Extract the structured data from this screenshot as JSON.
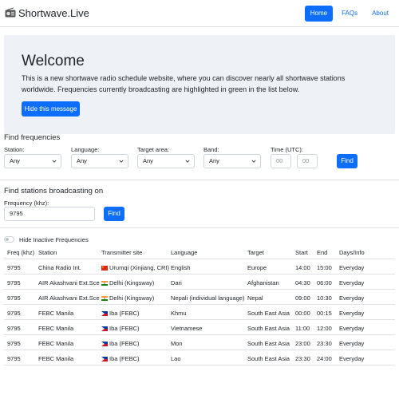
{
  "nav": {
    "brand": "Shortwave.Live",
    "links": [
      "Home",
      "FAQs",
      "About"
    ]
  },
  "hero": {
    "title": "Welcome",
    "text": "This is a new shortwave radio schedule website, where you can discover nearly all shortwave stations worldwide. Frequencies currently broadcasting are highlighted in green in the list below.",
    "button": "Hide this message"
  },
  "find_frequencies": {
    "title": "Find frequencies",
    "station_label": "Station:",
    "station_value": "Any",
    "language_label": "Language:",
    "language_value": "Any",
    "target_label": "Target area:",
    "target_value": "Any",
    "band_label": "Band:",
    "band_value": "Any",
    "time_label": "Time (UTC):",
    "time_placeholder_1": "00",
    "time_placeholder_2": "00",
    "find_button": "Find"
  },
  "find_stations": {
    "title": "Find stations broadcasting on",
    "freq_label": "Frequency (khz):",
    "freq_value": "9795",
    "find_button": "Find"
  },
  "toggle": {
    "label": "Hide Inactive Frequencies"
  },
  "table": {
    "headers": [
      "Freq (khz)",
      "Station",
      "Transmitter site",
      "Language",
      "Target",
      "Start",
      "End",
      "Days/Info"
    ],
    "rows": [
      {
        "freq": "9795",
        "station": "China Radio Int.",
        "flag": "cn",
        "site": "Urumqi (Xinjiang, CRI)",
        "language": "English",
        "target": "Europe",
        "start": "14:00",
        "end": "15:00",
        "days": "Everyday"
      },
      {
        "freq": "9795",
        "station": "AIR Akashvani Ext.Sce",
        "flag": "in",
        "site": "Delhi (Kingsway)",
        "language": "Dari",
        "target": "Afghanistan",
        "start": "04:30",
        "end": "06:00",
        "days": "Everyday"
      },
      {
        "freq": "9795",
        "station": "AIR Akashvani Ext.Sce",
        "flag": "in",
        "site": "Delhi (Kingsway)",
        "language": "Nepali (individual language)",
        "target": "Nepal",
        "start": "09:00",
        "end": "10:30",
        "days": "Everyday"
      },
      {
        "freq": "9795",
        "station": "FEBC Manila",
        "flag": "ph",
        "site": "Iba (FEBC)",
        "language": "Khmu",
        "target": "South East Asia",
        "start": "00:00",
        "end": "00:15",
        "days": "Everyday"
      },
      {
        "freq": "9795",
        "station": "FEBC Manila",
        "flag": "ph",
        "site": "Iba (FEBC)",
        "language": "Vietnamese",
        "target": "South East Asia",
        "start": "11:00",
        "end": "12:00",
        "days": "Everyday"
      },
      {
        "freq": "9795",
        "station": "FEBC Manila",
        "flag": "ph",
        "site": "Iba (FEBC)",
        "language": "Mon",
        "target": "South East Asia",
        "start": "23:00",
        "end": "23:30",
        "days": "Everyday"
      },
      {
        "freq": "9795",
        "station": "FEBC Manila",
        "flag": "ph",
        "site": "Iba (FEBC)",
        "language": "Lao",
        "target": "South East Asia",
        "start": "23:30",
        "end": "24:00",
        "days": "Everyday"
      }
    ]
  },
  "colors": {
    "primary": "#0d6efd",
    "hero_bg": "#eef1f5",
    "border": "#dee2e6"
  }
}
